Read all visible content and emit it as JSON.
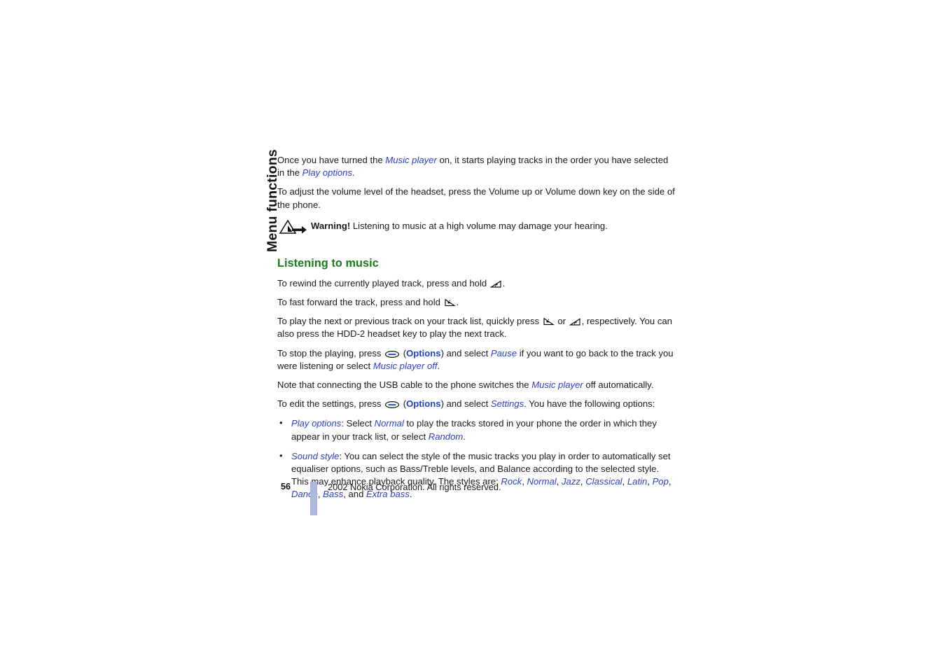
{
  "sidebar": {
    "tab_label": "Menu functions"
  },
  "content": {
    "para1": {
      "t1": "Once you have turned the ",
      "ui1": "Music player",
      "t2": " on, it starts playing tracks in the order you have selected in the ",
      "ui2": "Play options",
      "t3": "."
    },
    "para2": "To adjust the volume level of the headset, press the Volume up or Volume down key on the side of the phone.",
    "warning": {
      "icon": "warning-triangle-arrow-icon",
      "bold_label": "Warning!",
      "text": " Listening to music at a high volume may damage your hearing."
    },
    "heading": "Listening to music",
    "para_rewind": {
      "t1": "To rewind the currently played track, press and hold ",
      "icon": "scroll-left-key-icon",
      "t2": "."
    },
    "para_forward": {
      "t1": "To fast forward the track, press and hold ",
      "icon": "scroll-right-key-icon",
      "t2": "."
    },
    "para_nextprev": {
      "t1": "To play the next or previous track on your track list, quickly press ",
      "icon1": "scroll-right-key-icon",
      "t2": " or ",
      "icon2": "scroll-left-key-icon",
      "t3": ", respectively. You can also press the HDD-2 headset key to play the next track."
    },
    "para_stop": {
      "t1": "To stop the playing, press ",
      "icon": "options-soft-key-icon",
      "t2": " (",
      "key": "Options",
      "t3": ") and select ",
      "ui1": "Pause",
      "t4": " if you want to go back to the track you were listening or select ",
      "ui2": "Music player off",
      "t5": "."
    },
    "para_usb": {
      "t1": "Note that connecting the USB cable to the phone switches the ",
      "ui1": "Music player",
      "t2": " off automatically."
    },
    "para_settings": {
      "t1": "To edit the settings, press ",
      "icon": "options-soft-key-icon",
      "t2": " (",
      "key": "Options",
      "t3": ") and select ",
      "ui1": "Settings",
      "t4": ". You have the following options:"
    },
    "bullet_play_options": {
      "ui1": "Play options",
      "t1": ": Select ",
      "ui2": "Normal",
      "t2": " to play the tracks stored in your phone the order in which they appear in your track list, or select ",
      "ui3": "Random",
      "t3": "."
    },
    "bullet_sound_style": {
      "ui1": "Sound style",
      "t1": ": You can select the style of the music tracks you play in order to automatically set equaliser options, such as Bass/Treble levels, and Balance according to the selected style. This may enhance playback quality. The styles are: ",
      "styles": [
        "Rock",
        "Normal",
        "Jazz",
        "Classical",
        "Latin",
        "Pop",
        "Dance",
        "Bass"
      ],
      "t2": ", and ",
      "style_last": "Extra bass",
      "t3": "."
    }
  },
  "footer": {
    "page_number": "56",
    "copyright": "2002 Nokia Corporation. All rights reserved."
  },
  "colors": {
    "heading_green": "#1b7a1b",
    "ui_term_blue": "#2a3fd0",
    "key_blue": "#1b3fd4",
    "footer_bar": "#aab8e0",
    "body_text": "#1a1a1a"
  }
}
